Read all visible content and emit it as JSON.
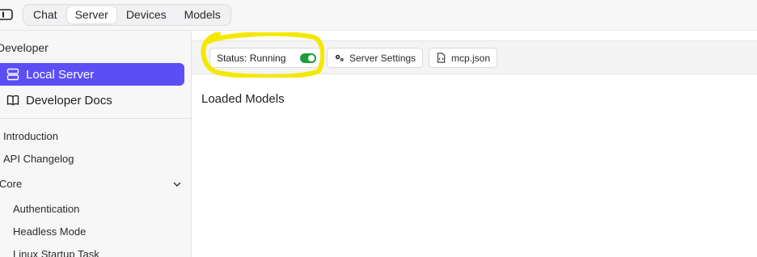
{
  "topbar": {
    "tabs": [
      {
        "label": "Chat",
        "active": false
      },
      {
        "label": "Server",
        "active": true
      },
      {
        "label": "Devices",
        "active": false
      },
      {
        "label": "Models",
        "active": false
      }
    ]
  },
  "sidebar": {
    "section_title": "Developer",
    "nav": [
      {
        "label": "Local Server",
        "icon": "server-icon",
        "active": true
      },
      {
        "label": "Developer Docs",
        "icon": "book-icon",
        "active": false
      }
    ],
    "docs": {
      "introduction": "Introduction",
      "api_changelog": "API Changelog",
      "core_group": "Core",
      "core_items": [
        "Authentication",
        "Headless Mode",
        "Linux Startup Task"
      ]
    }
  },
  "main": {
    "status_label": "Status: Running",
    "status_on": true,
    "server_settings_label": "Server Settings",
    "mcp_label": "mcp.json",
    "loaded_models_heading": "Loaded Models"
  },
  "colors": {
    "accent": "#5b4ef5",
    "toggle_on": "#1f9d3d",
    "highlight": "#f5e800"
  }
}
